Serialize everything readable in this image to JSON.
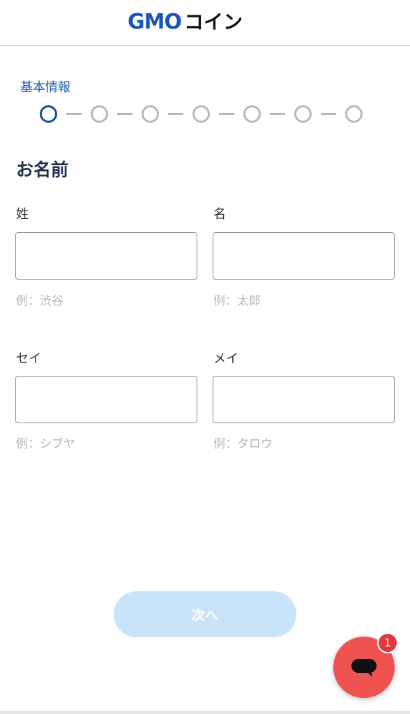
{
  "header": {
    "logo_gmo": "GMO",
    "logo_coin": "コイン"
  },
  "progress": {
    "step_label": "基本情報",
    "total_steps": 7,
    "current_step": 1
  },
  "section": {
    "title": "お名前"
  },
  "fields": {
    "last_name": {
      "label": "姓",
      "value": "",
      "hint": "例：渋谷"
    },
    "first_name": {
      "label": "名",
      "value": "",
      "hint": "例：太郎"
    },
    "last_name_kana": {
      "label": "セイ",
      "value": "",
      "hint": "例：シブヤ"
    },
    "first_name_kana": {
      "label": "メイ",
      "value": "",
      "hint": "例：タロウ"
    }
  },
  "actions": {
    "next_label": "次へ"
  },
  "chat": {
    "icon": "chat-bubble-icon",
    "badge_count": "1"
  },
  "colors": {
    "brand_blue": "#1a56b8",
    "accent_red": "#ef5350",
    "active_step": "#1a4d8f",
    "inactive_step": "#b7b7b7",
    "button_disabled": "#c9e3f8"
  }
}
